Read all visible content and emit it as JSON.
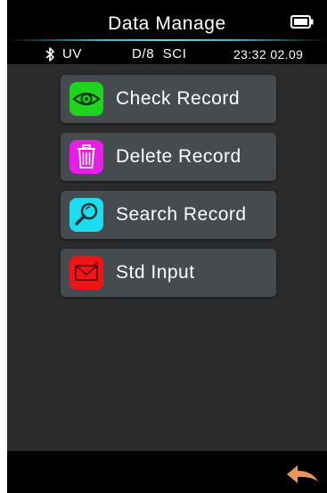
{
  "header": {
    "title": "Data Manage",
    "battery_icon": "battery-full-icon"
  },
  "status_bar": {
    "bluetooth_icon": "bluetooth-icon",
    "uv": "UV",
    "geometry": "D/8  SCI",
    "time": "23:32 02.09"
  },
  "menu": {
    "items": [
      {
        "label": "Check Record",
        "icon": "eye-icon",
        "color": "#1ed41e"
      },
      {
        "label": "Delete Record",
        "icon": "trash-icon",
        "color": "#e61ee6"
      },
      {
        "label": "Search Record",
        "icon": "magnifier-icon",
        "color": "#1edcf0"
      },
      {
        "label": "Std Input",
        "icon": "envelope-icon",
        "color": "#f01414"
      }
    ]
  },
  "footer": {
    "back_icon": "back-arrow-icon",
    "back_color": "#e8955a"
  },
  "colors": {
    "background": "#000000",
    "content_background": "#2b2b2b",
    "button_background": "#464b4f",
    "accent_line": "#49b9c5"
  }
}
